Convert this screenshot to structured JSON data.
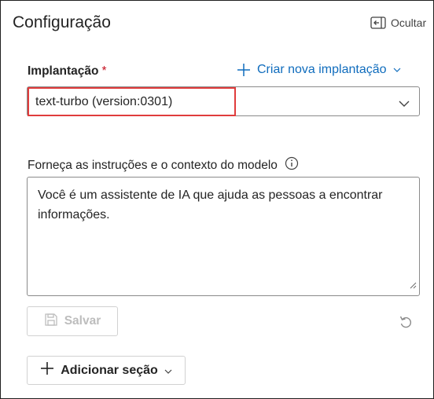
{
  "panel": {
    "title": "Configuração",
    "hide_label": "Ocultar"
  },
  "deployment": {
    "label": "Implantação",
    "required_marker": "*",
    "create_link_label": "Criar nova implantação",
    "selected_value": "text-turbo (version:0301)"
  },
  "instructions": {
    "label": "Forneça as instruções e o contexto do modelo",
    "text": "Você é um assistente de IA que ajuda as pessoas a encontrar informações."
  },
  "actions": {
    "save_label": "Salvar",
    "add_section_label": "Adicionar seção"
  },
  "colors": {
    "accent": "#0f6cbd",
    "required": "#c50f1f",
    "highlight": "#e03c3c"
  }
}
